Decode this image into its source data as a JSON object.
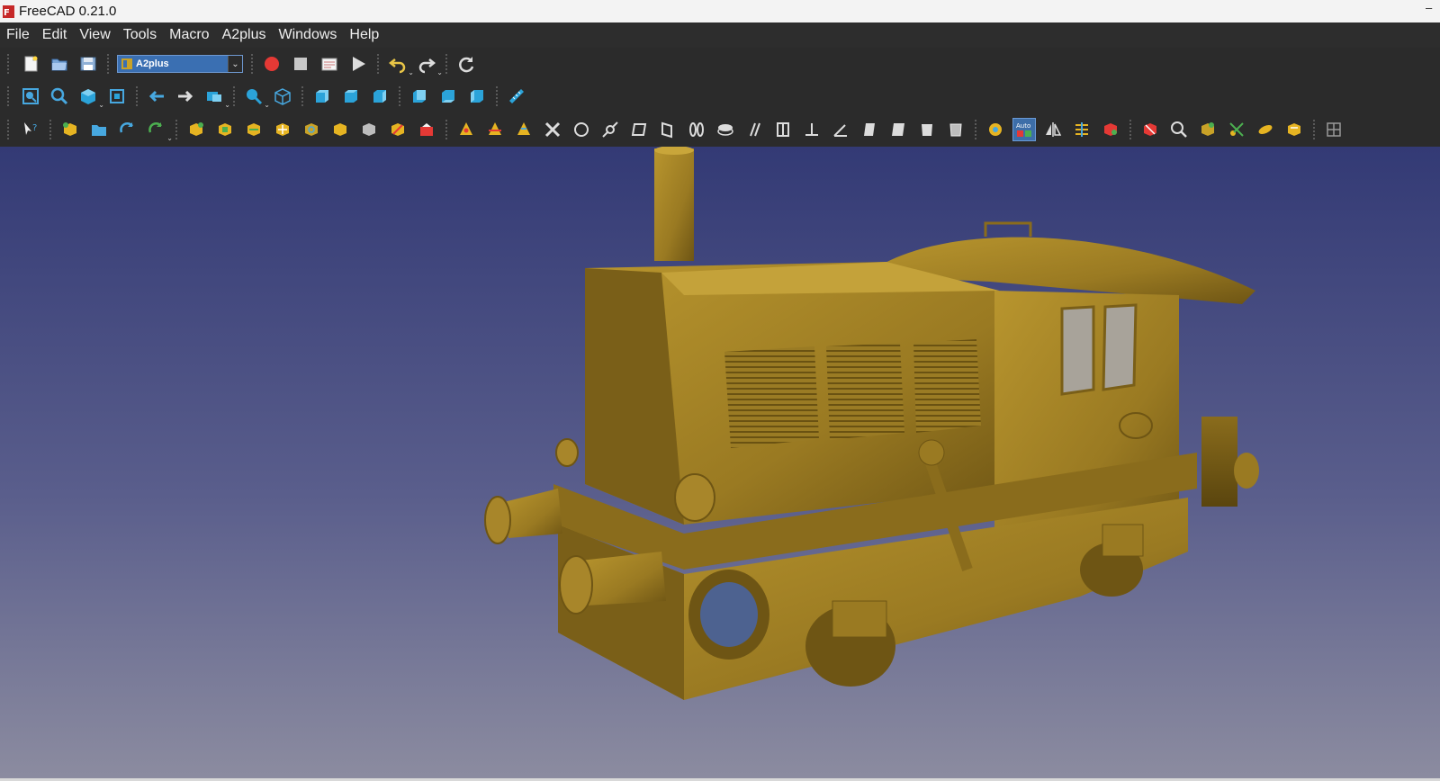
{
  "window": {
    "title": "FreeCAD 0.21.0",
    "minimize": "–"
  },
  "menu": [
    "File",
    "Edit",
    "View",
    "Tools",
    "Macro",
    "A2plus",
    "Windows",
    "Help"
  ],
  "workbench": {
    "selected": "A2plus"
  },
  "toolbar3": {
    "auto_label": "Auto"
  },
  "colors": {
    "titlebar": "#f3f3f3",
    "menubar": "#2d2d2d",
    "toolbar": "#2b2b2b",
    "viewport_top": "#333a75",
    "viewport_bottom": "#8c8ca0",
    "model": "#a7852a",
    "accent": "#3a6fb2"
  }
}
